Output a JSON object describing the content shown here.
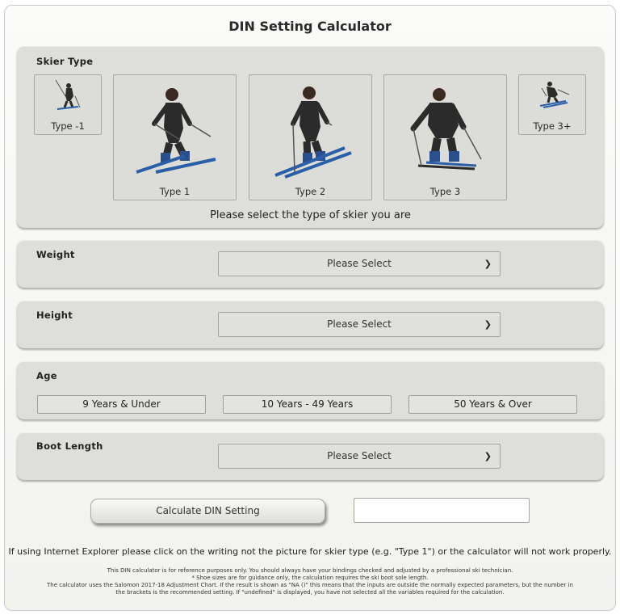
{
  "title": "DIN Setting Calculator",
  "skier_type": {
    "label": "Skier Type",
    "cards": [
      {
        "label": "Type -1"
      },
      {
        "label": "Type 1"
      },
      {
        "label": "Type 2"
      },
      {
        "label": "Type 3"
      },
      {
        "label": "Type 3+"
      }
    ],
    "hint": "Please select the type of skier you are"
  },
  "weight": {
    "label": "Weight",
    "value": "Please Select"
  },
  "height": {
    "label": "Height",
    "value": "Please Select"
  },
  "age": {
    "label": "Age",
    "options": [
      "9 Years & Under",
      "10 Years - 49 Years",
      "50 Years & Over"
    ]
  },
  "boot_length": {
    "label": "Boot Length",
    "value": "Please Select"
  },
  "calculate_label": "Calculate DIN Setting",
  "result_value": "",
  "ie_note": "If using Internet Explorer please click on the writing not the picture for skier type (e.g. \"Type 1\") or the calculator will not work properly.",
  "disclaimer": [
    "This DIN calculator is for reference purposes only. You should always have your bindings checked and adjusted by a professional ski technician.",
    "* Shoe sizes are for guidance only, the calculation requires the ski boot sole length.",
    "The calculator uses the Salomon 2017-18 Adjustment Chart. If the result is shown as \"NA ()\" this means that the inputs are outside the normally expected parameters, but the number in",
    "the brackets is the recommended setting. If \"undefined\" is displayed, you have not selected all the variables required for the calculation."
  ],
  "colors": {
    "panel": "#dededa",
    "skis": "#2a5fa8",
    "skier_body": "#2b2b2b"
  }
}
